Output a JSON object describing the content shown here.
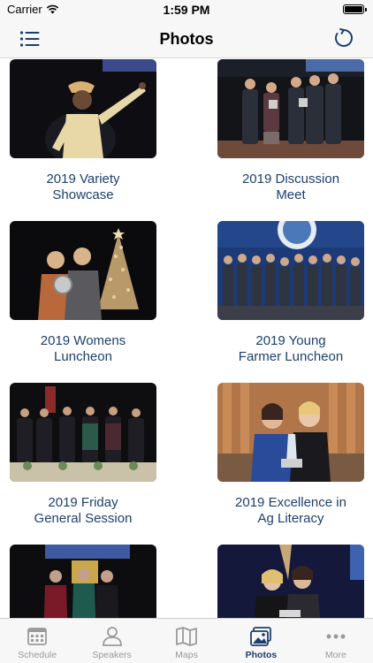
{
  "status": {
    "carrier": "Carrier",
    "time": "1:59 PM"
  },
  "nav": {
    "title": "Photos"
  },
  "albums": [
    {
      "line1": "2019 Variety",
      "line2": "Showcase"
    },
    {
      "line1": "2019 Discussion",
      "line2": "Meet"
    },
    {
      "line1": "2019 Womens",
      "line2": "Luncheon"
    },
    {
      "line1": "2019 Young",
      "line2": "Farmer Luncheon"
    },
    {
      "line1": "2019 Friday",
      "line2": "General Session"
    },
    {
      "line1": "2019 Excellence in",
      "line2": "Ag Literacy"
    },
    {
      "line1": "",
      "line2": ""
    },
    {
      "line1": "",
      "line2": ""
    }
  ],
  "tabs": [
    {
      "label": "Schedule",
      "icon": "calendar-icon"
    },
    {
      "label": "Speakers",
      "icon": "person-icon"
    },
    {
      "label": "Maps",
      "icon": "map-icon"
    },
    {
      "label": "Photos",
      "icon": "photos-icon"
    },
    {
      "label": "More",
      "icon": "more-icon"
    }
  ],
  "colors": {
    "accent": "#1d3f6e",
    "inactive": "#9a9a9a",
    "bar": "#f7f7f7"
  }
}
